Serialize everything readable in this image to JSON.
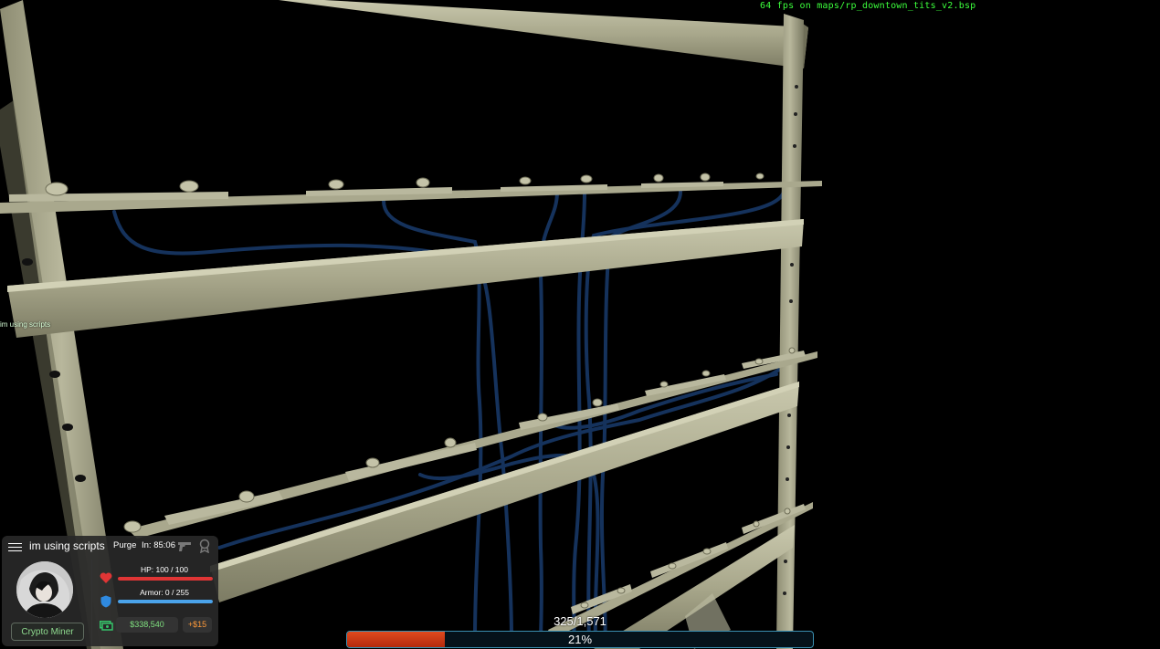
{
  "debug": {
    "fps_text": "64 fps on maps/rp_downtown_tits_v2.bsp"
  },
  "world": {
    "floating_label": "im using scripts"
  },
  "hud": {
    "player_name": "im using scripts",
    "purge_label": "Purge",
    "purge_time": "In: 85:06",
    "job": "Crypto Miner",
    "hp_text": "HP: 100 / 100",
    "hp_fraction": 1.0,
    "armor_text": "Armor: 0 / 255",
    "armor_fraction": 1.0,
    "money": "$338,540",
    "salary": "+$15",
    "colors": {
      "hp": "#e03535",
      "armor": "#4aa3ea",
      "money": "#7fe07f",
      "salary": "#ff9a3a"
    },
    "icons": [
      "menu-icon",
      "gun-icon",
      "license-icon",
      "heart-icon",
      "shield-icon",
      "money-icon"
    ]
  },
  "progress": {
    "count_text": "325/1,571",
    "percent_text": "21%",
    "fraction": 0.21,
    "fill_color": "#e04a1e"
  }
}
